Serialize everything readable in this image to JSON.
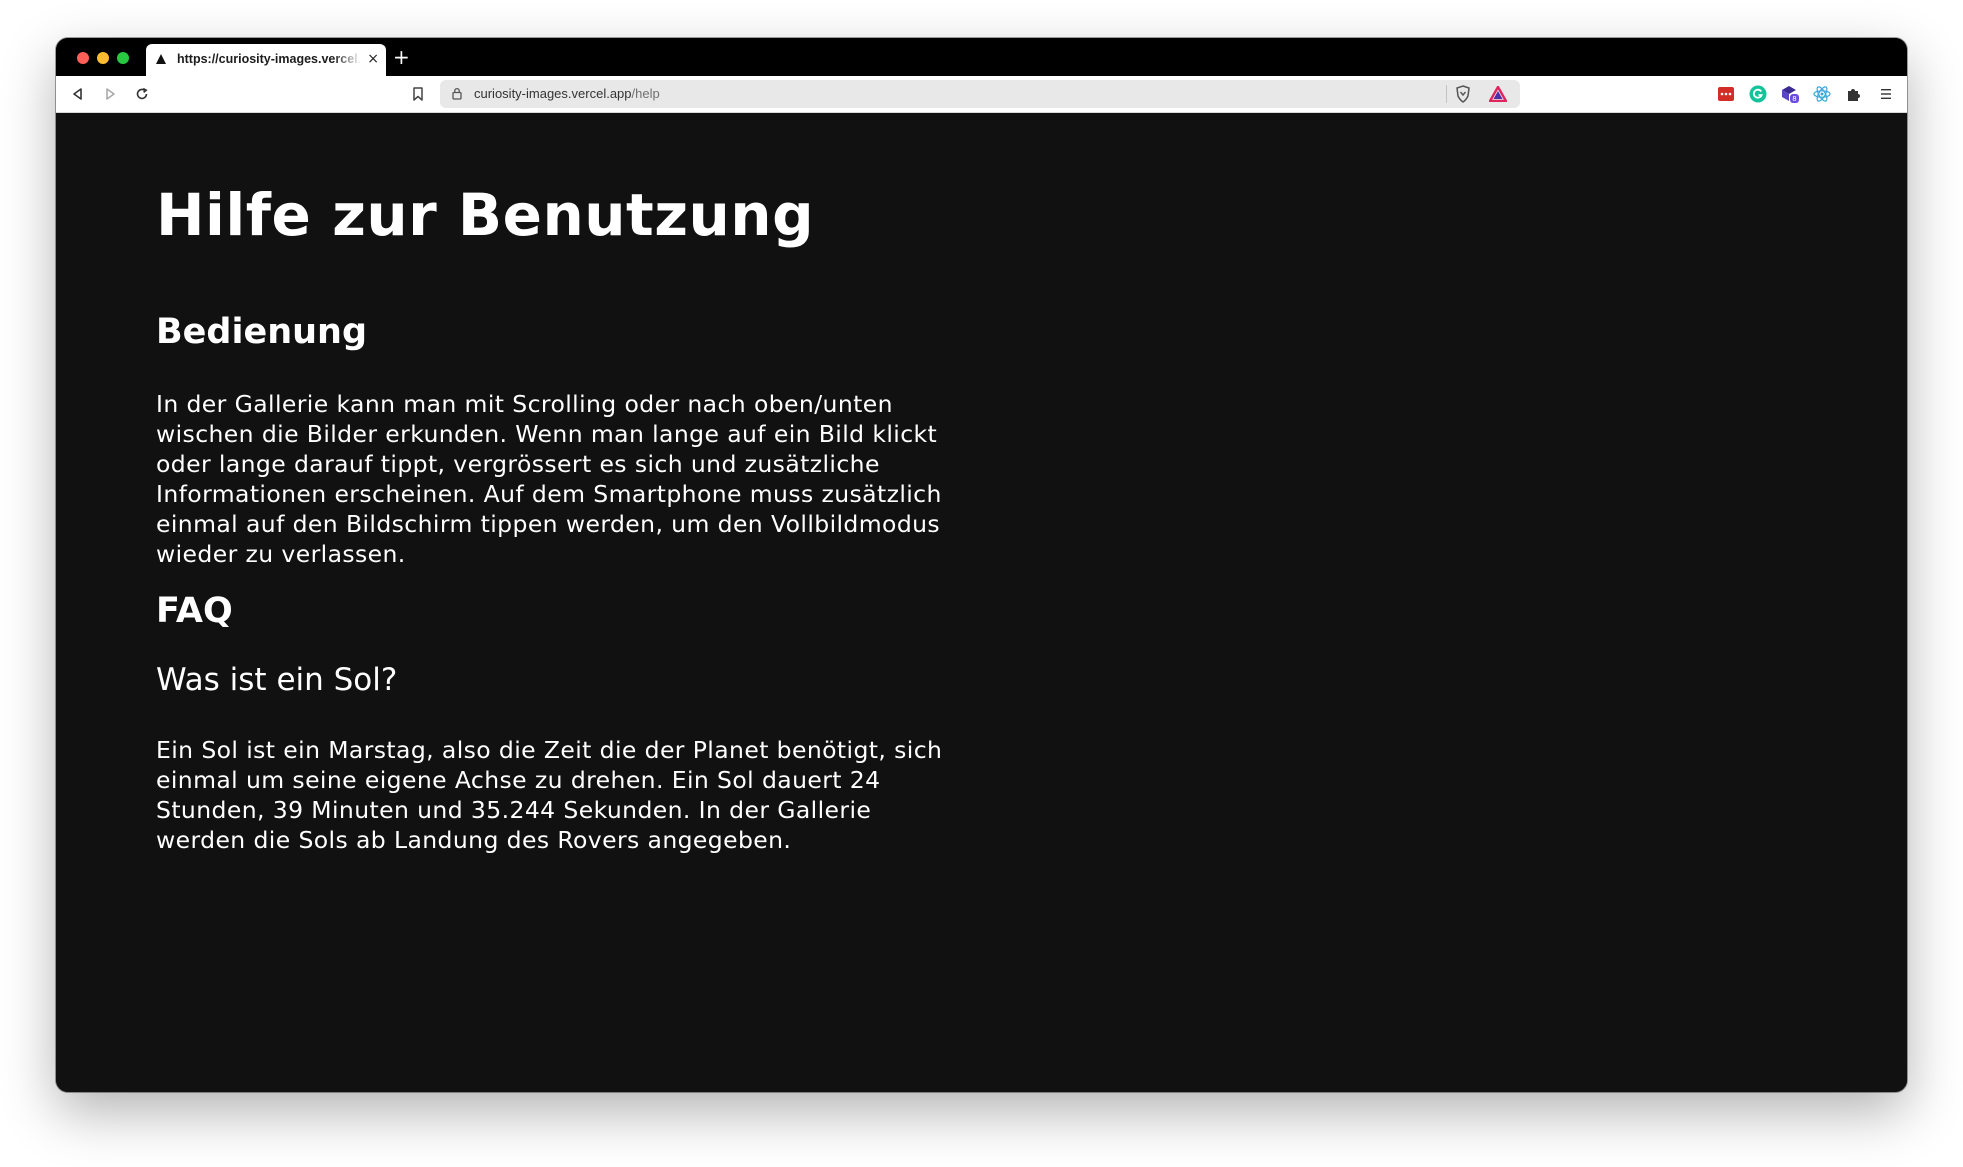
{
  "browser": {
    "tab": {
      "title": "https://curiosity-images.vercel.app/help",
      "close_glyph": "×",
      "favicon": "vercel-triangle-icon"
    },
    "new_tab_glyph": "+",
    "url": {
      "domain": "curiosity-images.vercel.app",
      "path": "/help"
    },
    "extensions": [
      "lastpass-icon",
      "grammarly-icon",
      "extension-badge-icon",
      "react-devtools-icon",
      "puzzle-icon",
      "menu-icon"
    ],
    "extension_badge_count": "8",
    "colors": {
      "tabstrip": "#000000",
      "toolbar": "#ffffff",
      "urlbar": "#e8e8e8"
    }
  },
  "page": {
    "title": "Hilfe zur Benutzung",
    "sections": {
      "bedienung": {
        "heading": "Bedienung",
        "text": "In der Gallerie kann man mit Scrolling oder nach oben/unten wischen die Bilder erkunden. Wenn man lange auf ein Bild klickt oder lange darauf tippt, vergrössert es sich und zusätzliche Informationen erscheinen. Auf dem Smartphone muss zusätzlich einmal auf den Bildschirm tippen werden, um den Vollbildmodus wieder zu verlassen."
      },
      "faq": {
        "heading": "FAQ",
        "question": "Was ist ein Sol?",
        "answer": "Ein Sol ist ein Marstag, also die Zeit die der Planet benötigt, sich einmal um seine eigene Achse zu drehen. Ein Sol dauert 24 Stunden, 39 Minuten und 35.244 Sekunden. In der Gallerie werden die Sols ab Landung des Rovers angegeben."
      }
    },
    "colors": {
      "background": "#111112",
      "text": "#ffffff"
    }
  }
}
